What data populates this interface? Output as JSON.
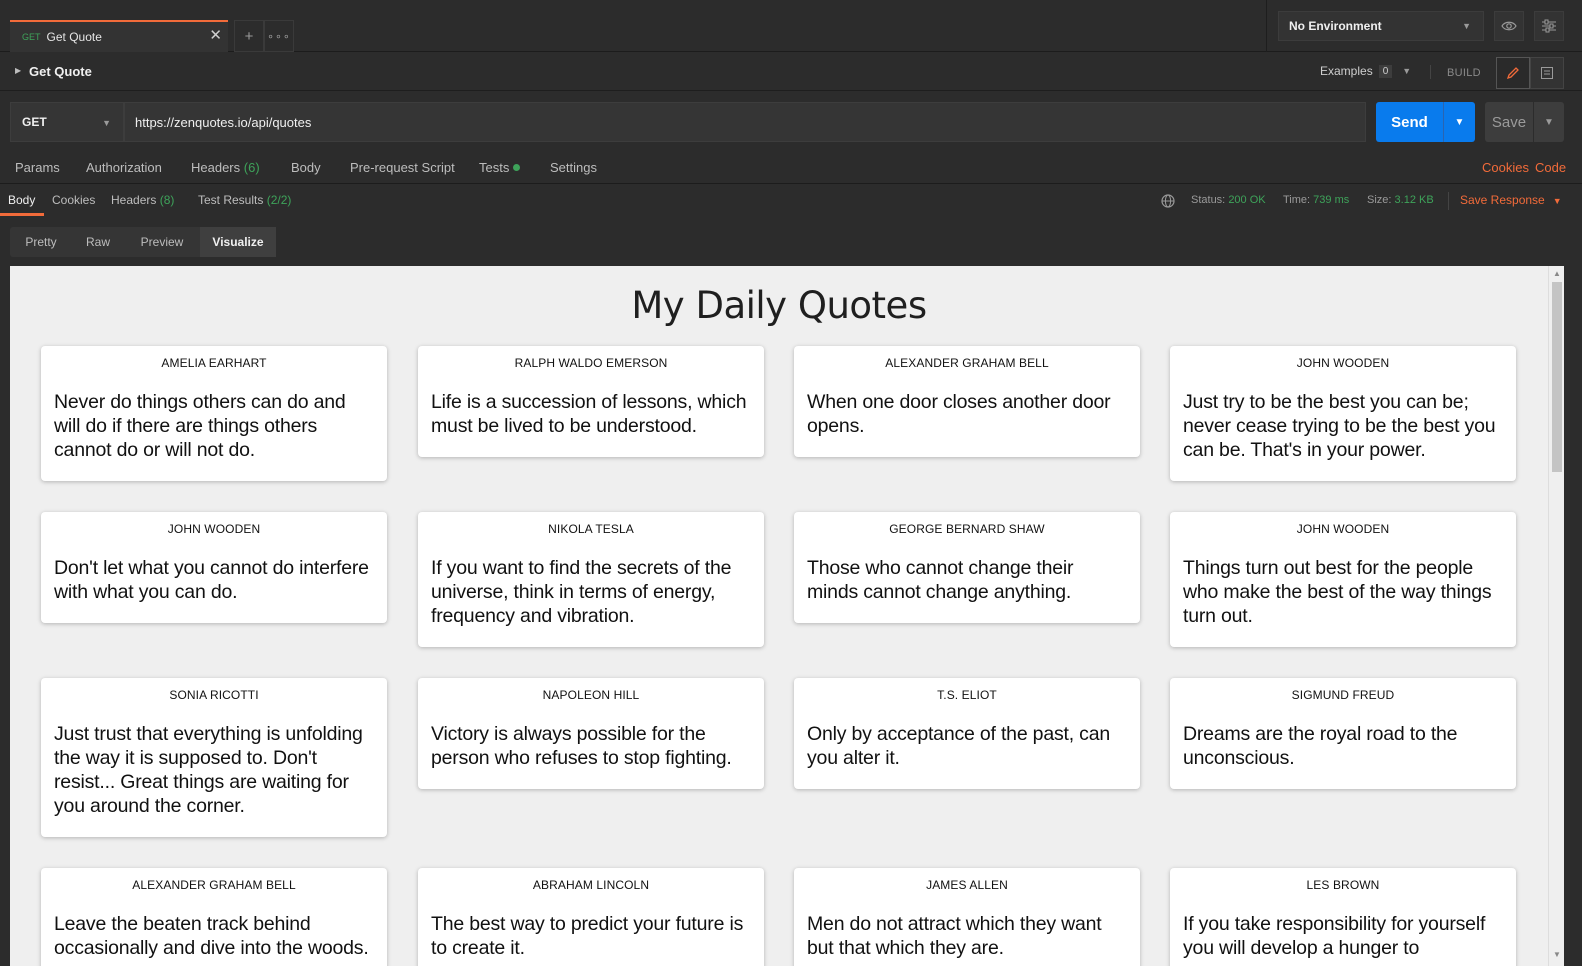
{
  "tab": {
    "method": "GET",
    "title": "Get Quote"
  },
  "environment": {
    "selected": "No Environment"
  },
  "request": {
    "name": "Get Quote",
    "examples_label": "Examples",
    "examples_count": "0",
    "build_label": "BUILD",
    "method": "GET",
    "url": "https://zenquotes.io/api/quotes",
    "send_label": "Send",
    "save_label": "Save"
  },
  "request_tabs": {
    "params": "Params",
    "authorization": "Authorization",
    "headers": "Headers",
    "headers_count": "(6)",
    "body": "Body",
    "prerequest": "Pre-request Script",
    "tests": "Tests",
    "settings": "Settings",
    "cookies": "Cookies",
    "code": "Code"
  },
  "response_tabs": {
    "body": "Body",
    "cookies": "Cookies",
    "headers": "Headers",
    "headers_count": "(8)",
    "test_results": "Test Results",
    "test_results_count": "(2/2)"
  },
  "response_stats": {
    "status_label": "Status:",
    "status_value": "200 OK",
    "time_label": "Time:",
    "time_value": "739 ms",
    "size_label": "Size:",
    "size_value": "3.12 KB",
    "save_response": "Save Response"
  },
  "view_modes": {
    "pretty": "Pretty",
    "raw": "Raw",
    "preview": "Preview",
    "visualize": "Visualize"
  },
  "visualize": {
    "title": "My Daily Quotes",
    "quotes": [
      {
        "author": "AMELIA EARHART",
        "text": "Never do things others can do and will do if there are things others cannot do or will not do."
      },
      {
        "author": "RALPH WALDO EMERSON",
        "text": "Life is a succession of lessons, which must be lived to be understood."
      },
      {
        "author": "ALEXANDER GRAHAM BELL",
        "text": "When one door closes another door opens."
      },
      {
        "author": "JOHN WOODEN",
        "text": "Just try to be the best you can be; never cease trying to be the best you can be. That's in your power."
      },
      {
        "author": "JOHN WOODEN",
        "text": "Don't let what you cannot do interfere with what you can do."
      },
      {
        "author": "NIKOLA TESLA",
        "text": "If you want to find the secrets of the universe, think in terms of energy, frequency and vibration."
      },
      {
        "author": "GEORGE BERNARD SHAW",
        "text": "Those who cannot change their minds cannot change anything."
      },
      {
        "author": "JOHN WOODEN",
        "text": "Things turn out best for the people who make the best of the way things turn out."
      },
      {
        "author": "SONIA RICOTTI",
        "text": "Just trust that everything is unfolding the way it is supposed to. Don't resist... Great things are waiting for you around the corner."
      },
      {
        "author": "NAPOLEON HILL",
        "text": "Victory is always possible for the person who refuses to stop fighting."
      },
      {
        "author": "T.S. ELIOT",
        "text": "Only by acceptance of the past, can you alter it."
      },
      {
        "author": "SIGMUND FREUD",
        "text": "Dreams are the royal road to the unconscious."
      },
      {
        "author": "ALEXANDER GRAHAM BELL",
        "text": "Leave the beaten track behind occasionally and dive into the woods."
      },
      {
        "author": "ABRAHAM LINCOLN",
        "text": "The best way to predict your future is to create it."
      },
      {
        "author": "JAMES ALLEN",
        "text": "Men do not attract which they want but that which they are."
      },
      {
        "author": "LES BROWN",
        "text": "If you take responsibility for yourself you will develop a hunger to"
      }
    ]
  },
  "colors": {
    "accent": "#f26b3a",
    "send": "#097bed",
    "success": "#3ea35a"
  }
}
